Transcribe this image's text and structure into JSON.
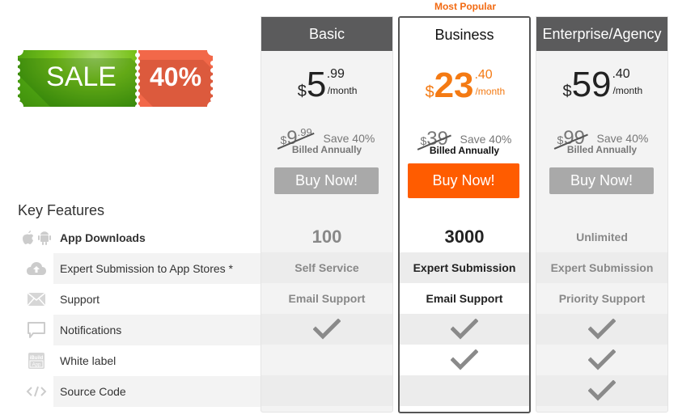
{
  "banner": {
    "sale_label": "SALE",
    "discount_label": "40%"
  },
  "most_popular_label": "Most Popular",
  "key_features_title": "Key Features",
  "features": [
    {
      "icon": "apple-android-icon",
      "label": "App Downloads"
    },
    {
      "icon": "cloud-upload-icon",
      "label": "Expert Submission to App Stores *"
    },
    {
      "icon": "envelope-icon",
      "label": "Support"
    },
    {
      "icon": "chat-bubble-icon",
      "label": "Notifications"
    },
    {
      "icon": "ibuild-app-icon",
      "label": "White label"
    },
    {
      "icon": "code-icon",
      "label": "Source Code"
    }
  ],
  "plans": [
    {
      "name": "Basic",
      "currency": "$",
      "price_whole": "5",
      "price_cents": ".99",
      "period": "/month",
      "old_currency": "$",
      "old_whole": "9",
      "old_cents": ".99",
      "save_label": "Save 40%",
      "billing": "Billed Annually",
      "button_label": "Buy Now!",
      "values": {
        "app_downloads": "100",
        "submission": "Self Service",
        "support": "Email Support",
        "notifications": true,
        "white_label": false,
        "source_code": false
      }
    },
    {
      "name": "Business",
      "featured": true,
      "currency": "$",
      "price_whole": "23",
      "price_cents": ".40",
      "period": "/month",
      "old_currency": "$",
      "old_whole": "39",
      "old_cents": "",
      "save_label": "Save 40%",
      "billing": "Billed Annually",
      "button_label": "Buy Now!",
      "values": {
        "app_downloads": "3000",
        "submission": "Expert Submission",
        "support": "Email Support",
        "notifications": true,
        "white_label": true,
        "source_code": false
      }
    },
    {
      "name": "Enterprise/Agency",
      "currency": "$",
      "price_whole": "59",
      "price_cents": ".40",
      "period": "/month",
      "old_currency": "$",
      "old_whole": "99",
      "old_cents": "",
      "save_label": "Save 40%",
      "billing": "Billed Annually",
      "button_label": "Buy Now!",
      "values": {
        "app_downloads": "Unlimited",
        "submission": "Expert Submission",
        "support": "Priority Support",
        "notifications": true,
        "white_label": true,
        "source_code": true
      }
    }
  ],
  "colors": {
    "accent_orange": "#ff5c00",
    "price_orange": "#f47a13",
    "header_gray": "#5b5b5c",
    "button_gray": "#a9a9a9",
    "sale_green": "#5aac12",
    "sale_red": "#f26849"
  }
}
